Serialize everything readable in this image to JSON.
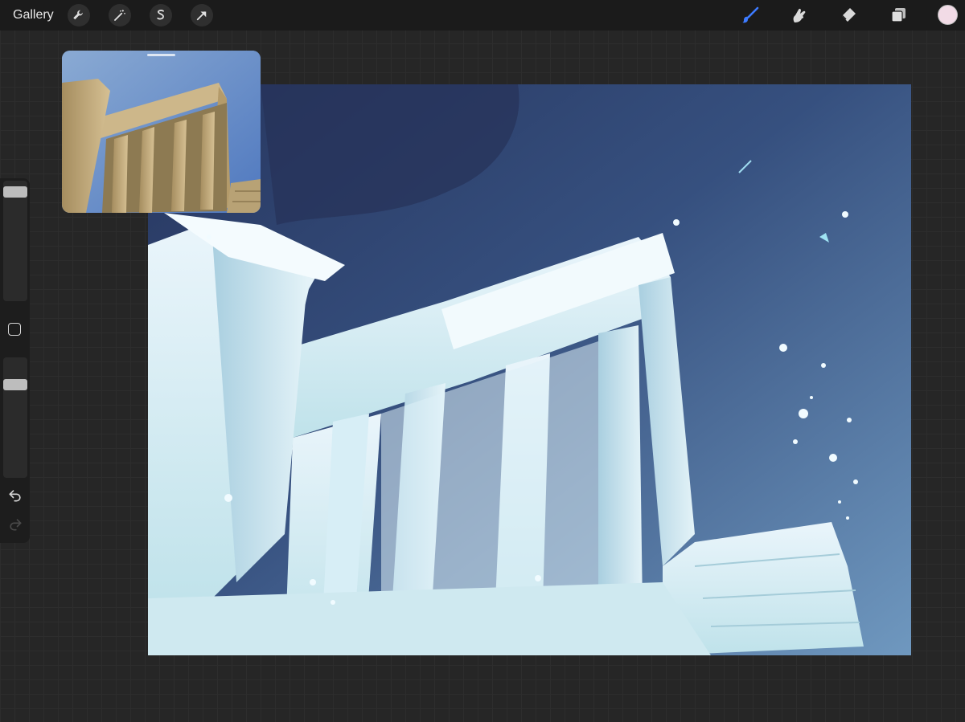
{
  "app": {
    "title": "Gallery"
  },
  "top_left_tools": [
    {
      "name": "actions",
      "icon": "wrench-icon"
    },
    {
      "name": "adjustments",
      "icon": "magic-wand-icon"
    },
    {
      "name": "selection",
      "icon": "selection-s-icon"
    },
    {
      "name": "transform",
      "icon": "arrow-cursor-icon"
    }
  ],
  "top_right_tools": [
    {
      "name": "brush",
      "icon": "brush-icon",
      "active": true
    },
    {
      "name": "smudge",
      "icon": "smudge-icon",
      "active": false
    },
    {
      "name": "eraser",
      "icon": "eraser-icon",
      "active": false
    },
    {
      "name": "layers",
      "icon": "layers-icon",
      "active": false
    }
  ],
  "colors": {
    "active_tool": "#3d7bff",
    "current_color": "#f2dbe6",
    "topbar": "#1b1b1b",
    "background": "#262626"
  },
  "sidebar": {
    "brush_size_level": 0.95,
    "opacity_level": 0.8,
    "undo_icon": "undo-icon",
    "redo_icon": "redo-icon"
  }
}
